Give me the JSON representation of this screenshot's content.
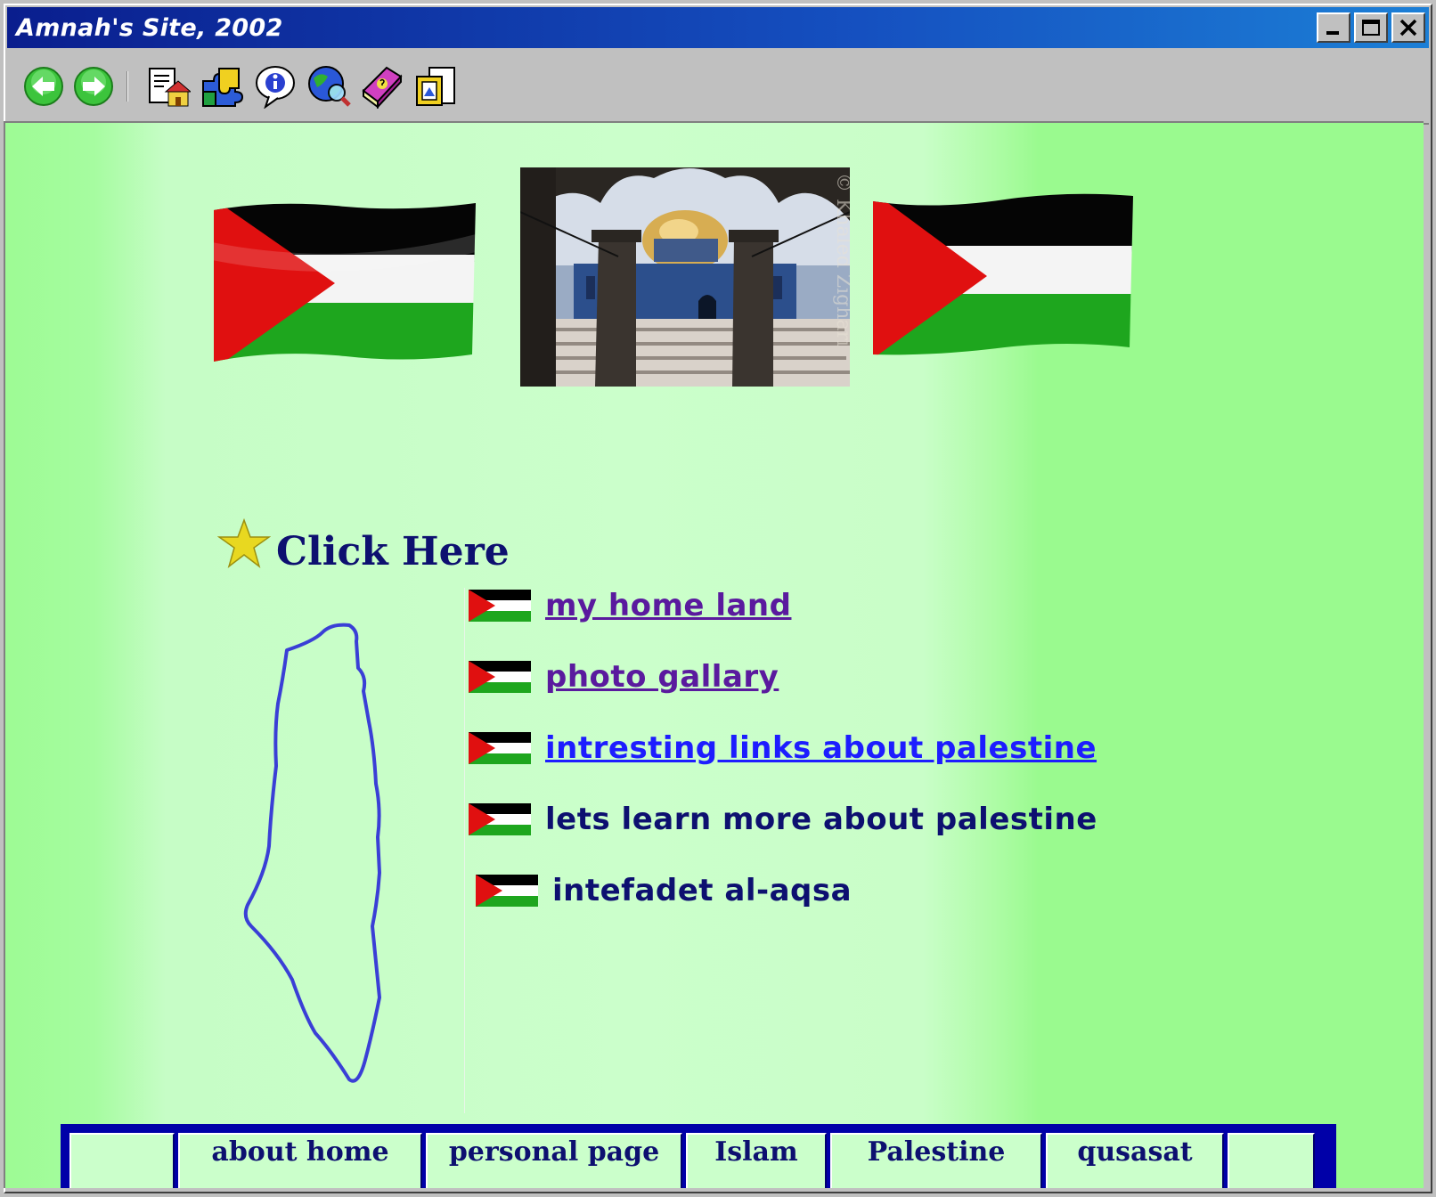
{
  "window": {
    "title": "Amnah's Site, 2002",
    "controls": [
      "minimize",
      "maximize",
      "close"
    ]
  },
  "toolbar": {
    "buttons": [
      {
        "name": "back",
        "icon": "back-arrow-icon"
      },
      {
        "name": "forward",
        "icon": "forward-arrow-icon"
      },
      {
        "name": "home",
        "icon": "home-page-icon"
      },
      {
        "name": "puzzle",
        "icon": "puzzle-icon"
      },
      {
        "name": "info",
        "icon": "info-bubble-icon"
      },
      {
        "name": "globe",
        "icon": "globe-search-icon"
      },
      {
        "name": "help-book",
        "icon": "help-book-icon"
      },
      {
        "name": "frames",
        "icon": "picture-frame-icon"
      }
    ]
  },
  "header": {
    "photo_watermark": "© Khaled Zighari"
  },
  "click_here": "Click Here",
  "links": [
    {
      "label": "my home land",
      "style": "visited"
    },
    {
      "label": "photo gallary",
      "style": "visited"
    },
    {
      "label": "intresting links about palestine",
      "style": "unvisited"
    },
    {
      "label": "lets learn more about palestine",
      "style": "plain"
    },
    {
      "label": "intefadet al-aqsa",
      "style": "plain"
    }
  ],
  "nav": {
    "cells": [
      "",
      "about home",
      "personal page",
      "Islam",
      "Palestine",
      "qusasat",
      ""
    ]
  },
  "colors": {
    "background_light": "#cbffcb",
    "background_edge": "#9afa8f",
    "title_blue": "#0d1070",
    "visited_link": "#5a1a9e",
    "link": "#1d1dff",
    "nav_border": "#0000a8",
    "map_outline": "#3a3fd6"
  }
}
